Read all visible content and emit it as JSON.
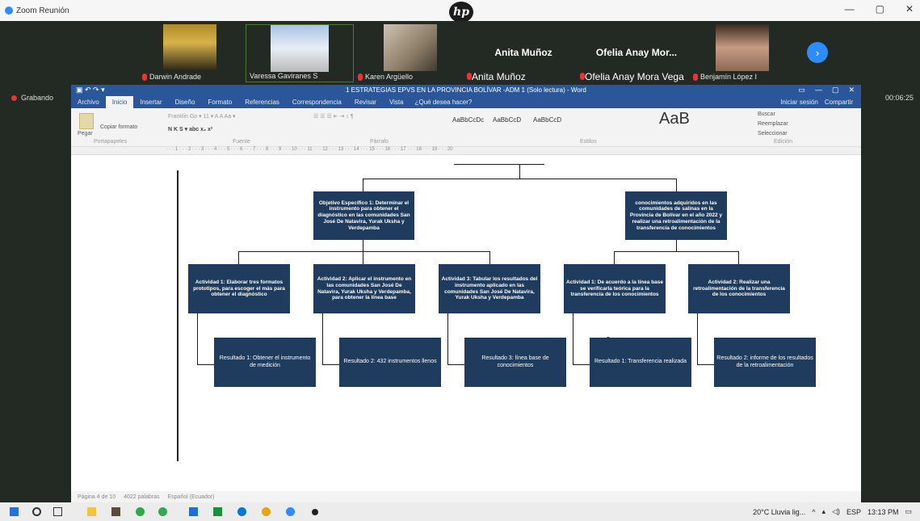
{
  "zoom": {
    "title": "Zoom Reunión",
    "recording": "Grabando",
    "timer": "00:06:25",
    "window_controls": [
      "—",
      "▢",
      "✕"
    ]
  },
  "participants": [
    {
      "name": "Darwin Andrade"
    },
    {
      "name": "Varessa Gaviranes S"
    },
    {
      "name": "Karen Argüello"
    },
    {
      "name": "Anita Muñoz",
      "big": "Anita Muñoz"
    },
    {
      "name": "Ofelia Anay Mora Vega",
      "big": "Ofelia Anay Mor..."
    },
    {
      "name": "Benjamín López I"
    }
  ],
  "word": {
    "title": "1 ESTRATEGIAS EPVS EN LA PROVINCIA BOLÍVAR -ADM 1 (Solo lectura) - Word",
    "tabs": [
      "Archivo",
      "Inicio",
      "Insertar",
      "Diseño",
      "Formato",
      "Referencias",
      "Correspondencia",
      "Revisar",
      "Vista"
    ],
    "tell_me": "¿Qué desea hacer?",
    "sign_in": "Iniciar sesión",
    "share": "Compartir",
    "ribbon": {
      "paste": "Pegar",
      "format_painter": "Copiar formato",
      "styles": [
        "AaBbCcDc",
        "AaBbCcD",
        "AaBbCcD"
      ],
      "style_big": "AaB",
      "find": "Buscar",
      "replace": "Reemplazar",
      "select": "Seleccionar",
      "groups": [
        "Portapapeles",
        "Fuente",
        "Párrafo",
        "Estilos",
        "Edición"
      ]
    },
    "status": {
      "page": "Página 4 de 10",
      "words": "4022 palabras",
      "lang": "Español (Ecuador)"
    }
  },
  "diagram": {
    "top_left": "Objetivo Específico 1: Determinar el instrumento para obtener el diagnóstico en las comunidades San José De Natavira, Yurak Uksha y Verdepamba",
    "top_right": "conocimientos adquiridos en las comunidades de salinas en la Provincia de Bolívar en el año 2022 y realizar una retroalimentación de la transferencia de conocimientos",
    "activities": [
      "Actividad 1: Elaborar tres formatos prototipos, para escoger el más para obtener el diagnóstico",
      "Actividad 2: Aplicar el instrumento en las comunidades San José De Natavira, Yurak Uksha y Verdepamba, para obtener la línea base",
      "Actividad 3: Tabular los resultados del instrumento aplicado en las comunidades San José De Natavira, Yurak Uksha y Verdepamba",
      "Actividad 1: De acuerdo a la línea base se verificarla teórica para la transferencia de los conocimientos",
      "Actividad 2: Realizar una retroalimentación de la transferencia de los conocimientos"
    ],
    "results": [
      "Resultado 1: Obtener el instrumento de medición",
      "Resultado 2: 432 instrumentos llenos",
      "Resultado 3: línea base de conocimientos",
      "Resultado 1: Transferencia realizada",
      "Resultado 2: informe de los resultados de la retroalimentación"
    ]
  },
  "taskbar": {
    "weather": "20°C  Lluvia lig...",
    "lang": "ESP",
    "time": "13:13 PM"
  }
}
